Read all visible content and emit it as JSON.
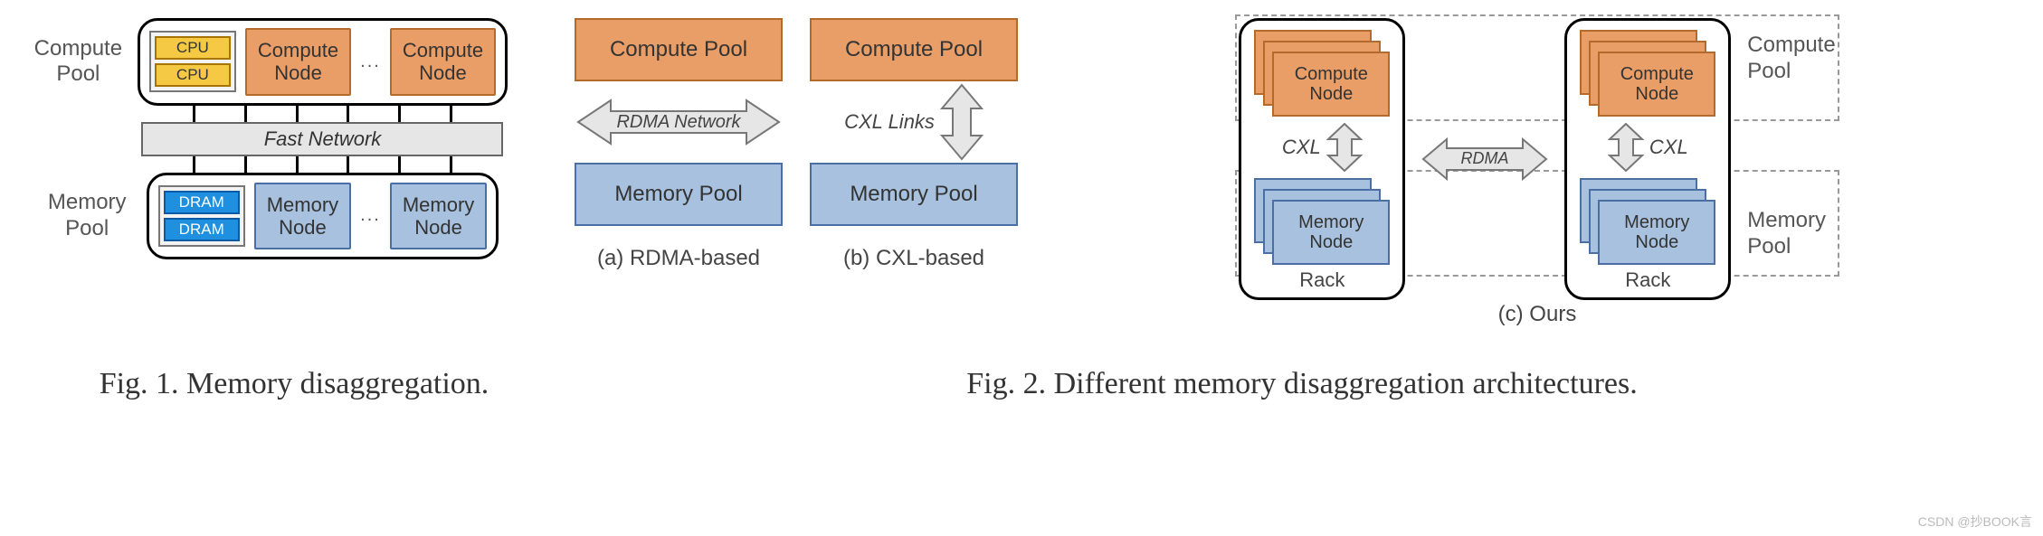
{
  "fig1": {
    "compute_pool_label_l1": "Compute",
    "compute_pool_label_l2": "Pool",
    "memory_pool_label_l1": "Memory",
    "memory_pool_label_l2": "Pool",
    "cpu_label": "CPU",
    "dram_label": "DRAM",
    "compute_node_l1": "Compute",
    "compute_node_l2": "Node",
    "memory_node_l1": "Memory",
    "memory_node_l2": "Node",
    "ellipsis": "...",
    "fast_network": "Fast Network",
    "caption": "Fig. 1.  Memory disaggregation."
  },
  "fig2": {
    "a": {
      "compute_pool": "Compute Pool",
      "memory_pool": "Memory Pool",
      "link": "RDMA Network",
      "caption": "(a) RDMA-based"
    },
    "b": {
      "compute_pool": "Compute Pool",
      "memory_pool": "Memory Pool",
      "link": "CXL Links",
      "caption": "(b) CXL-based"
    },
    "c": {
      "compute_node_l1": "Compute",
      "compute_node_l2": "Node",
      "memory_node_l1": "Memory",
      "memory_node_l2": "Node",
      "cxl": "CXL",
      "rdma": "RDMA",
      "rack": "Rack",
      "compute_pool_l1": "Compute",
      "compute_pool_l2": "Pool",
      "memory_pool_l1": "Memory",
      "memory_pool_l2": "Pool",
      "caption": "(c) Ours"
    },
    "caption": "Fig. 2.  Different memory disaggregation architectures."
  },
  "watermark": "CSDN @抄BOOK言"
}
